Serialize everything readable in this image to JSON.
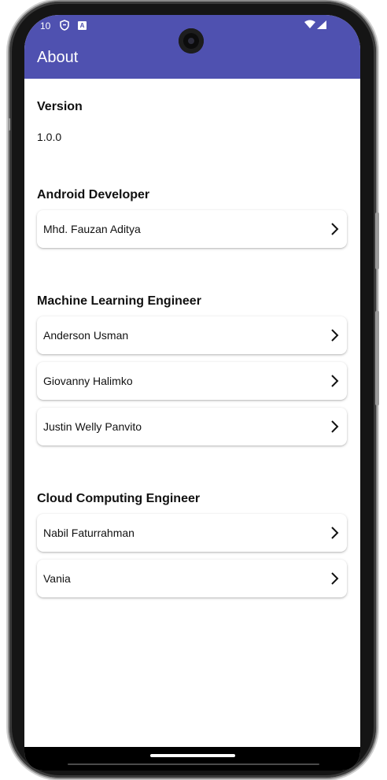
{
  "status_bar": {
    "time": "10",
    "icons": [
      "shield-icon",
      "accessibility-badge-icon",
      "wifi-icon",
      "signal-icon"
    ]
  },
  "app_bar": {
    "title": "About",
    "color": "#4f51b0"
  },
  "version": {
    "title": "Version",
    "value": "1.0.0"
  },
  "sections": [
    {
      "title": "Android Developer",
      "members": [
        "Mhd. Fauzan Aditya"
      ]
    },
    {
      "title": "Machine Learning Engineer",
      "members": [
        "Anderson Usman",
        "Giovanny Halimko",
        "Justin Welly Panvito"
      ]
    },
    {
      "title": "Cloud Computing Engineer",
      "members": [
        "Nabil Faturrahman",
        "Vania"
      ]
    }
  ]
}
